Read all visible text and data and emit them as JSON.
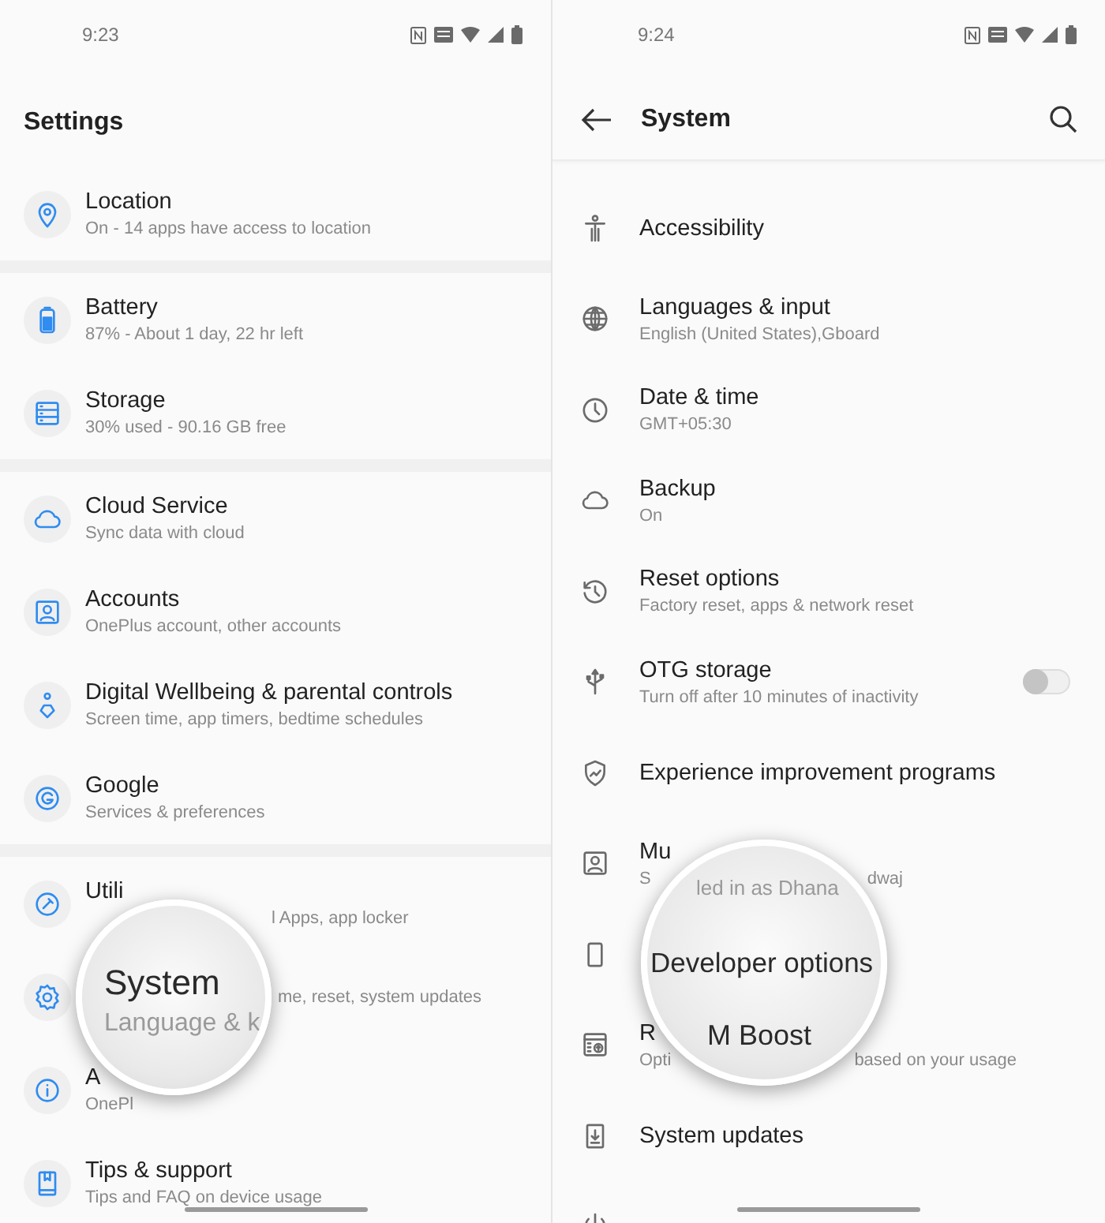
{
  "screens": [
    {
      "status_bar": {
        "time": "9:23"
      },
      "header": {
        "title": "Settings"
      },
      "groups": [
        [
          {
            "title": "Location",
            "subtitle": "On - 14 apps have access to location"
          }
        ],
        [
          {
            "title": "Battery",
            "subtitle": "87% - About 1 day, 22 hr left"
          },
          {
            "title": "Storage",
            "subtitle": "30% used - 90.16 GB free"
          }
        ],
        [
          {
            "title": "Cloud Service",
            "subtitle": "Sync data with cloud"
          },
          {
            "title": "Accounts",
            "subtitle": "OnePlus account, other accounts"
          },
          {
            "title": "Digital Wellbeing & parental controls",
            "subtitle": "Screen time, app timers, bedtime schedules"
          },
          {
            "title": "Google",
            "subtitle": "Services & preferences"
          }
        ],
        [
          {
            "title": "Utili",
            "subtitle_tail": "l Apps, app locker"
          },
          {
            "subtitle_tail": "me, reset, system updates"
          },
          {
            "title": "A",
            "subtitle": "OnePl"
          },
          {
            "title": "Tips & support",
            "subtitle": "Tips and FAQ on device usage"
          }
        ]
      ],
      "magnifier": [
        {
          "text": "System",
          "kind": "title"
        },
        {
          "text": "Language & k",
          "kind": "faint"
        }
      ]
    },
    {
      "status_bar": {
        "time": "9:24"
      },
      "header": {
        "title": "System"
      },
      "items": [
        {
          "title": "Accessibility"
        },
        {
          "title": "Languages & input",
          "subtitle": "English (United States),Gboard"
        },
        {
          "title": "Date & time",
          "subtitle": "GMT+05:30"
        },
        {
          "title": "Backup",
          "subtitle": "On"
        },
        {
          "title": "Reset options",
          "subtitle": "Factory reset, apps & network reset"
        },
        {
          "title": "OTG storage",
          "subtitle": "Turn off after 10 minutes of inactivity",
          "on": false
        },
        {
          "title": "Experience improvement programs"
        },
        {
          "title": "Mu",
          "subtitle": "S",
          "subtitle_tail": "dwaj"
        },
        {
          "kind": "icon_only"
        },
        {
          "title": "R",
          "subtitle": "Opti",
          "subtitle_tail": "based on your usage"
        },
        {
          "title": "System updates"
        },
        {
          "kind": "icon_only"
        }
      ],
      "magnifier": [
        {
          "text": "led in as Dhana",
          "kind": "faint"
        },
        {
          "text": "Developer options",
          "kind": "title"
        },
        {
          "text": "M Boost",
          "kind": "lower"
        }
      ]
    }
  ]
}
